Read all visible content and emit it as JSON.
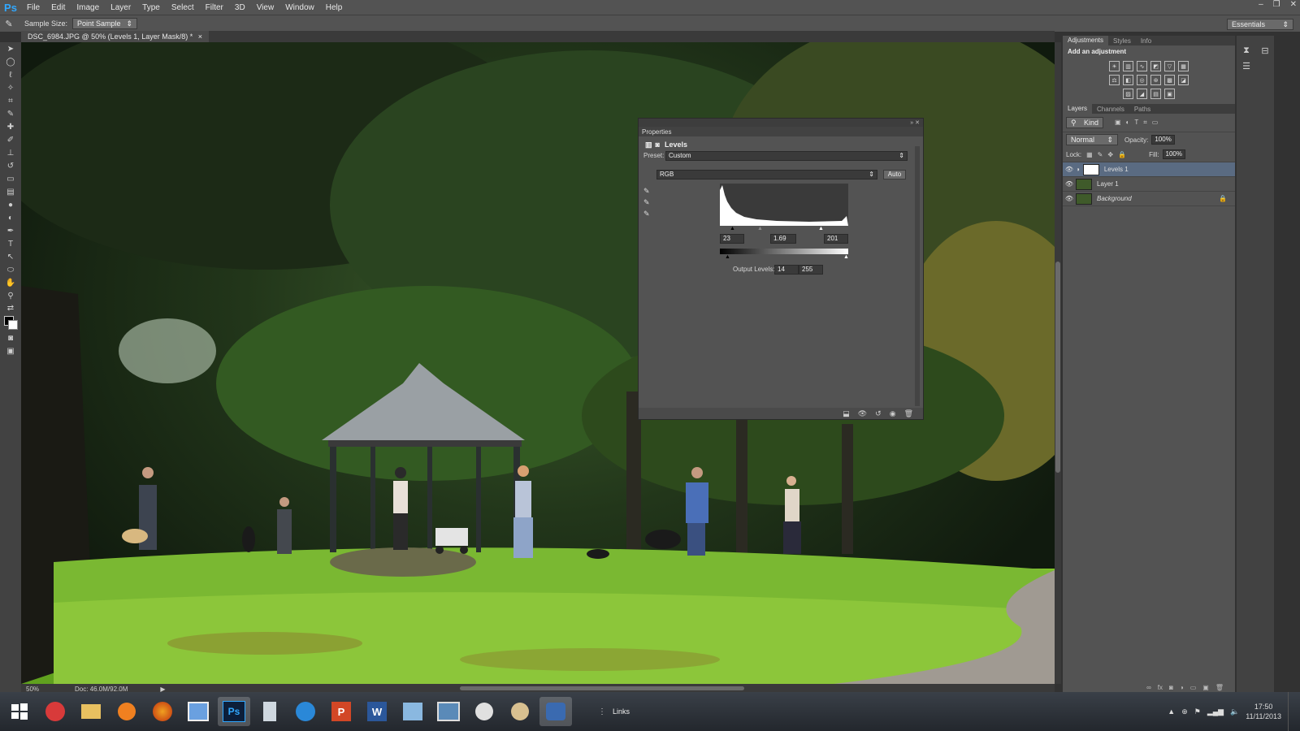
{
  "app": {
    "logo_text": "Ps",
    "brand_color": "#31a8ff"
  },
  "menu": {
    "items": [
      "File",
      "Edit",
      "Image",
      "Layer",
      "Type",
      "Select",
      "Filter",
      "3D",
      "View",
      "Window",
      "Help"
    ]
  },
  "window_controls": [
    "–",
    "❐",
    "✕"
  ],
  "options_bar": {
    "tool_icon": "eyedropper-icon",
    "sample_size_label": "Sample Size:",
    "sample_size_value": "Point Sample",
    "workspace": "Essentials"
  },
  "document": {
    "tab_title": "DSC_6984.JPG @ 50% (Levels 1, Layer Mask/8) *",
    "close": "×"
  },
  "status": {
    "zoom": "50%",
    "doc_size": "Doc: 46.0M/92.0M"
  },
  "properties": {
    "panel_title": "Properties",
    "panel_name": "Levels",
    "preset_label": "Preset:",
    "preset_value": "Custom",
    "channel_value": "RGB",
    "auto_label": "Auto",
    "input_black": "23",
    "input_gamma": "1.69",
    "input_white": "201",
    "output_label": "Output Levels:",
    "output_black": "14",
    "output_white": "255"
  },
  "adjustments_panel": {
    "tabs": [
      "Adjustments",
      "Styles",
      "Info"
    ],
    "heading": "Add an adjustment"
  },
  "layers_panel": {
    "tabs": [
      "Layers",
      "Channels",
      "Paths"
    ],
    "kind_filter": "Kind",
    "blend_mode": "Normal",
    "opacity_label": "Opacity:",
    "opacity_value": "100%",
    "lock_label": "Lock:",
    "fill_label": "Fill:",
    "fill_value": "100%",
    "layers": [
      {
        "name": "Levels 1",
        "selected": true
      },
      {
        "name": "Layer 1",
        "selected": false
      },
      {
        "name": "Background",
        "selected": false
      }
    ]
  },
  "taskbar": {
    "links_label": "Links",
    "time": "17:50",
    "date": "11/11/2013",
    "apps": [
      "start-icon",
      "stamp-app-icon",
      "file-explorer-icon",
      "media-player-icon",
      "firefox-icon",
      "picture-app-icon",
      "photoshop-icon",
      "calculator-icon",
      "browser-icon",
      "powerpoint-icon",
      "word-icon",
      "outlook-icon",
      "screenshot-app-icon",
      "scissors-app-icon",
      "paint-app-icon",
      "camera-app-icon"
    ],
    "app_labels": {
      "photoshop": "Ps",
      "powerpoint": "P",
      "word": "W"
    }
  }
}
